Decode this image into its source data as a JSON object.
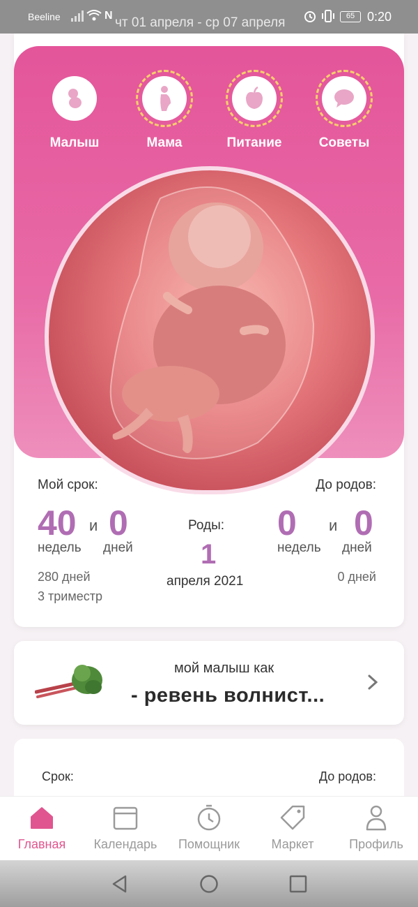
{
  "status_bar": {
    "carrier": "Beeline",
    "date_range": "чт 01 апреля - ср 07 апреля",
    "battery": "65",
    "time": "0:20"
  },
  "top_nav": {
    "items": [
      {
        "label": "Малыш",
        "icon": "baby-icon"
      },
      {
        "label": "Мама",
        "icon": "mother-icon"
      },
      {
        "label": "Питание",
        "icon": "apple-icon"
      },
      {
        "label": "Советы",
        "icon": "chat-bubble-icon"
      }
    ]
  },
  "stats": {
    "my_term_label": "Мой срок:",
    "my_weeks": "40",
    "and": "и",
    "my_days": "0",
    "weeks_label": "недель",
    "days_label": "дней",
    "total_days": "280 дней",
    "trimester": "3 триместр",
    "birth_label": "Роды:",
    "birth_day": "1",
    "birth_month_year": "апреля 2021",
    "until_birth_label": "До родов:",
    "left_weeks": "0",
    "left_days": "0",
    "left_total_days": "0 дней"
  },
  "baby_like": {
    "caption": "мой малыш как",
    "name": "- ревень волнист..."
  },
  "term_card": {
    "term_label": "Срок:",
    "until_label": "До родов:"
  },
  "tab_bar": {
    "tabs": [
      {
        "label": "Главная",
        "icon": "home-icon",
        "active": true
      },
      {
        "label": "Календарь",
        "icon": "calendar-icon",
        "active": false
      },
      {
        "label": "Помощник",
        "icon": "timer-icon",
        "active": false
      },
      {
        "label": "Маркет",
        "icon": "tag-icon",
        "active": false
      },
      {
        "label": "Профиль",
        "icon": "profile-icon",
        "active": false
      }
    ]
  },
  "colors": {
    "accent": "#e0558f",
    "number_purple": "#b06db3",
    "panel_pink": "#e4559a",
    "dash_yellow": "#f5d06b"
  }
}
